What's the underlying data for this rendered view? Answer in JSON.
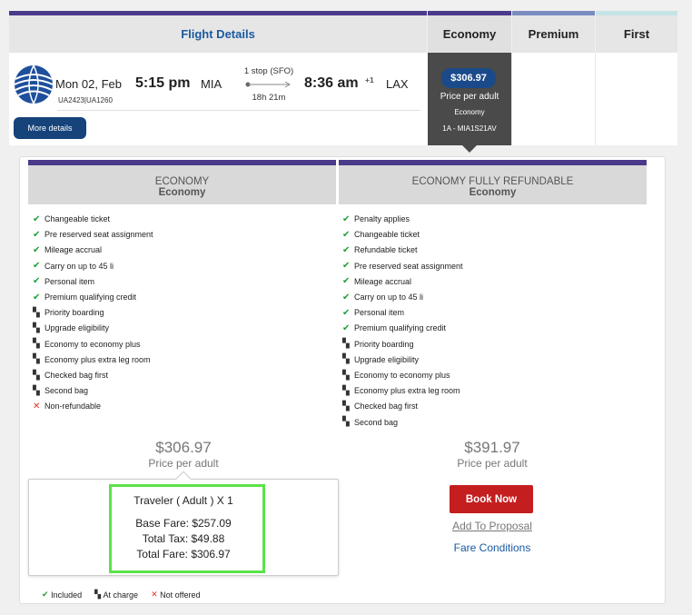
{
  "header": {
    "details_label": "Flight Details",
    "cabins": [
      "Economy",
      "Premium",
      "First"
    ],
    "colors": {
      "economy_bar": "#4b3a8a",
      "premium_bar": "#7b8cc0",
      "first_bar": "#c6e4e8",
      "details_text": "#1a5aa0"
    }
  },
  "flight": {
    "airline_logo": "united-globe-logo",
    "date": "Mon 02, Feb",
    "flight_codes": "UA2423|UA1260",
    "depart_time": "5:15 pm",
    "origin": "MIA",
    "stops": "1 stop (SFO)",
    "duration": "18h 21m",
    "arrive_time": "8:36 am",
    "day_offset": "+1",
    "destination": "LAX",
    "more_details_label": "More details"
  },
  "economy_cell": {
    "price": "$306.97",
    "price_caption": "Price per adult",
    "cabin": "Economy",
    "fare_code": "1A - MIA1S21AV"
  },
  "fares": [
    {
      "title": "ECONOMY",
      "subtitle": "Economy",
      "features": [
        {
          "status": "included",
          "label": "Changeable ticket"
        },
        {
          "status": "included",
          "label": "Pre reserved seat assignment"
        },
        {
          "status": "included",
          "label": "Mileage accrual"
        },
        {
          "status": "included",
          "label": "Carry on up to 45 li"
        },
        {
          "status": "included",
          "label": "Personal item"
        },
        {
          "status": "included",
          "label": "Premium qualifying credit"
        },
        {
          "status": "charge",
          "label": "Priority boarding"
        },
        {
          "status": "charge",
          "label": "Upgrade eligibility"
        },
        {
          "status": "charge",
          "label": "Economy to economy plus"
        },
        {
          "status": "charge",
          "label": "Economy plus extra leg room"
        },
        {
          "status": "charge",
          "label": "Checked bag first"
        },
        {
          "status": "charge",
          "label": "Second bag"
        },
        {
          "status": "not_offered",
          "label": "Non-refundable"
        }
      ],
      "price": "$306.97",
      "price_caption": "Price per adult"
    },
    {
      "title": "ECONOMY FULLY REFUNDABLE",
      "subtitle": "Economy",
      "features": [
        {
          "status": "included",
          "label": "Penalty applies"
        },
        {
          "status": "included",
          "label": "Changeable ticket"
        },
        {
          "status": "included",
          "label": "Refundable ticket"
        },
        {
          "status": "included",
          "label": "Pre reserved seat assignment"
        },
        {
          "status": "included",
          "label": "Mileage accrual"
        },
        {
          "status": "included",
          "label": "Carry on up to 45 li"
        },
        {
          "status": "included",
          "label": "Personal item"
        },
        {
          "status": "included",
          "label": "Premium qualifying credit"
        },
        {
          "status": "charge",
          "label": "Priority boarding"
        },
        {
          "status": "charge",
          "label": "Upgrade eligibility"
        },
        {
          "status": "charge",
          "label": "Economy to economy plus"
        },
        {
          "status": "charge",
          "label": "Economy plus extra leg room"
        },
        {
          "status": "charge",
          "label": "Checked bag first"
        },
        {
          "status": "charge",
          "label": "Second bag"
        }
      ],
      "price": "$391.97",
      "price_caption": "Price per adult",
      "book_label": "Book Now",
      "proposal_label": "Add To Proposal",
      "conditions_label": "Fare Conditions"
    }
  ],
  "breakdown": {
    "traveler": "Traveler ( Adult ) X 1",
    "base_fare": "Base Fare: $257.09",
    "total_tax": "Total Tax: $49.88",
    "total_fare": "Total Fare: $306.97"
  },
  "legend": {
    "included": "Included",
    "charge": "At charge",
    "not_offered": "Not offered"
  }
}
